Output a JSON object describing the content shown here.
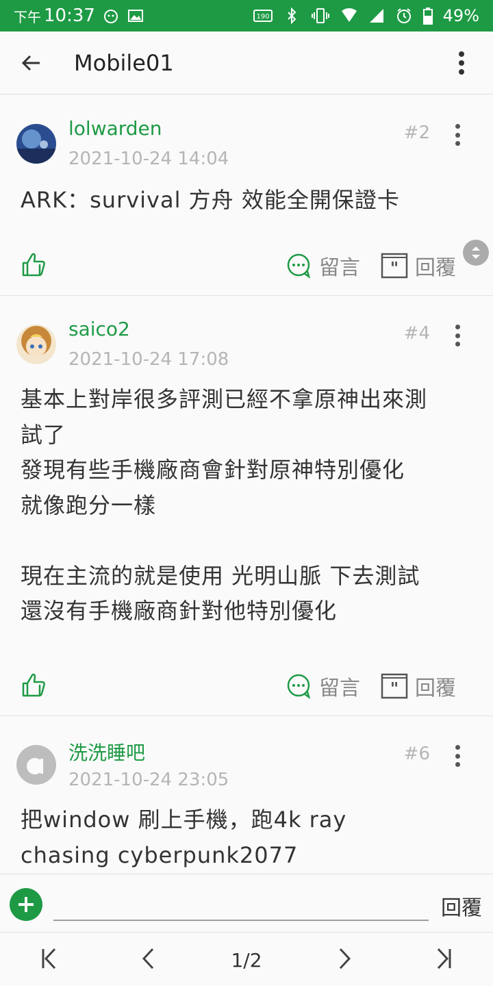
{
  "status_bar": {
    "time_prefix": "下午",
    "time": "10:37",
    "battery": "49%"
  },
  "app_bar": {
    "title": "Mobile01"
  },
  "posts": [
    {
      "author": "lolwarden",
      "date": "2021-10-24 14:04",
      "floor": "#2",
      "content": "ARK：survival 方舟 效能全開保證卡",
      "comment_label": "留言",
      "reply_label": "回覆"
    },
    {
      "author": "saico2",
      "date": "2021-10-24 17:08",
      "floor": "#4",
      "content": "基本上對岸很多評測已經不拿原神出來測\n試了\n發現有些手機廠商會針對原神特別優化\n就像跑分一樣\n\n現在主流的就是使用 光明山脈 下去測試\n還沒有手機廠商針對他特別優化",
      "comment_label": "留言",
      "reply_label": "回覆"
    },
    {
      "author": "洗洗睡吧",
      "date": "2021-10-24 23:05",
      "floor": "#6",
      "content": "把window 刷上手機，跑4k ray\nchasing cyberpunk2077"
    }
  ],
  "reply_bar": {
    "placeholder": "",
    "send_label": "回覆"
  },
  "pager": {
    "page": "1/2"
  },
  "colors": {
    "brand_green": "#1e9a45",
    "meta_gray": "#b5b5b5"
  }
}
